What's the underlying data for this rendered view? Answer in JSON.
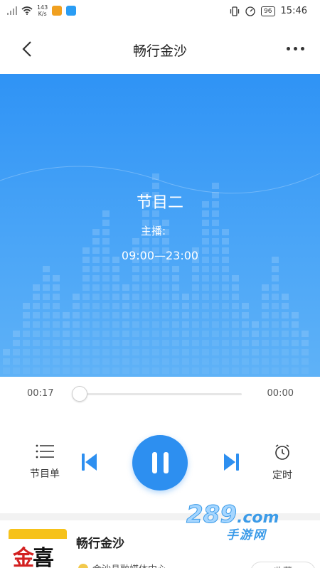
{
  "status_bar": {
    "net_speed_value": "143",
    "net_speed_unit": "K/s",
    "battery": "96",
    "time": "15:46"
  },
  "nav": {
    "title": "畅行金沙",
    "back_icon": "chevron-left-icon",
    "more_icon": "more-dots-icon"
  },
  "hero": {
    "program_title": "节目二",
    "host_label": "主播:",
    "time_range": "09:00—23:00",
    "accent_color": "#2f93f5"
  },
  "player": {
    "current_time": "00:17",
    "total_time": "00:00",
    "progress": 0,
    "list_label": "节目单",
    "timer_label": "定时",
    "play_state": "playing",
    "accent_color": "#2d8ff0"
  },
  "station": {
    "name": "畅行金沙",
    "subtitle": "金沙县融媒体中心",
    "follow_label": "收藏"
  },
  "watermark": {
    "number": "289",
    "domain": ".com",
    "site_name": "手游网"
  }
}
